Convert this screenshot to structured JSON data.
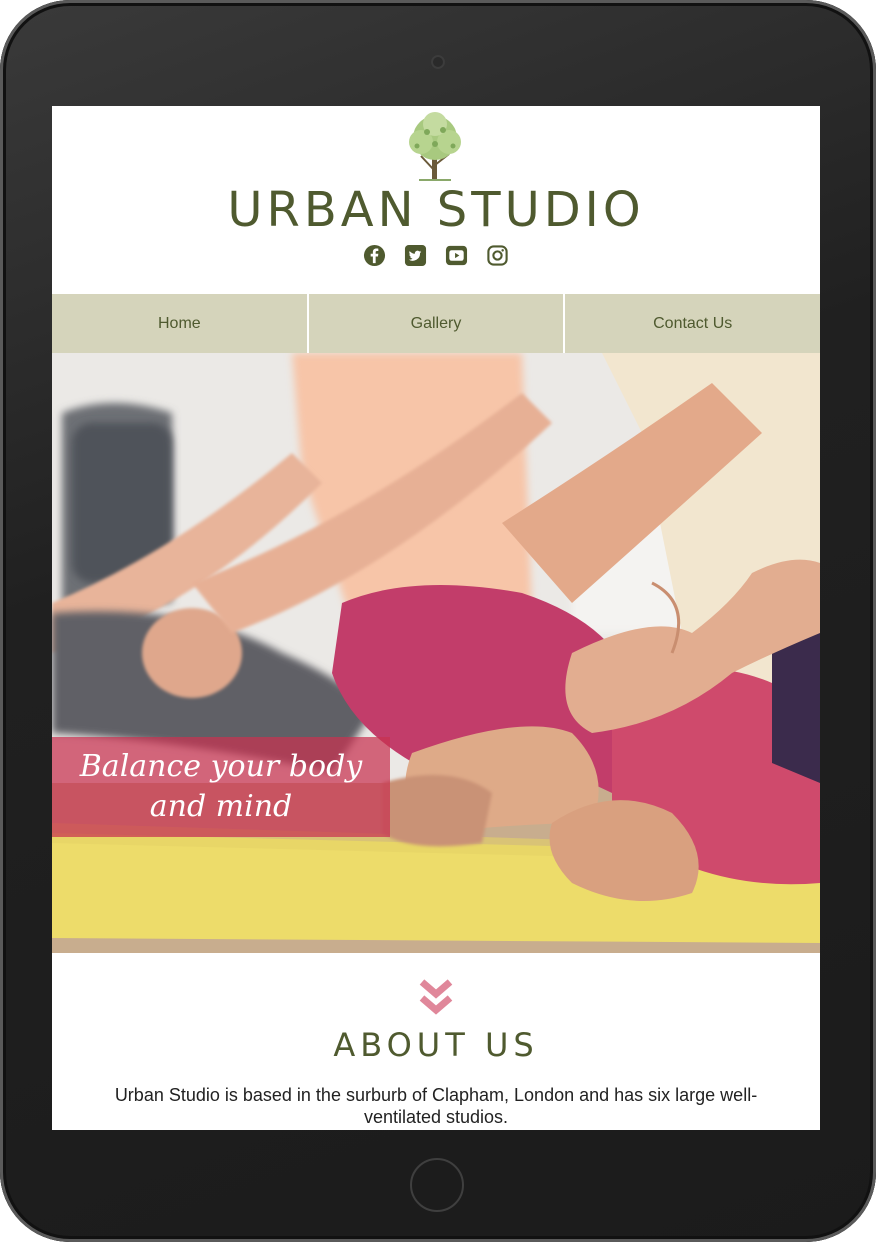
{
  "site": {
    "title": "URBAN STUDIO"
  },
  "social": {
    "icons": [
      "facebook-icon",
      "twitter-icon",
      "youtube-icon",
      "instagram-icon"
    ]
  },
  "nav": {
    "items": [
      {
        "label": "Home"
      },
      {
        "label": "Gallery"
      },
      {
        "label": "Contact Us"
      }
    ]
  },
  "hero": {
    "tagline": "Balance your body and mind"
  },
  "about": {
    "title": "ABOUT US",
    "text": "Urban Studio is based in the surburb of Clapham, London and has six large well-ventilated studios."
  },
  "colors": {
    "brand_green": "#4f5a2f",
    "nav_bg": "#d5d4bb",
    "accent_pink": "#e0879a",
    "tagline_bg": "#c83250"
  }
}
